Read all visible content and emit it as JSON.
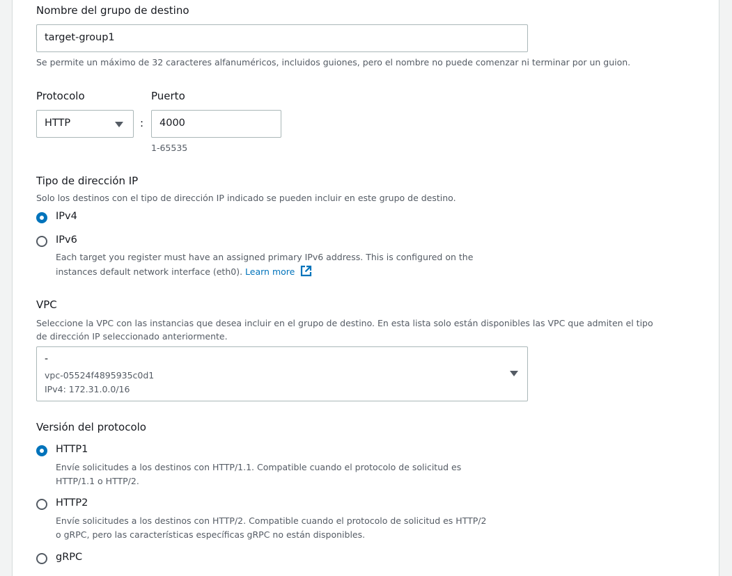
{
  "target_group_name": {
    "label": "Nombre del grupo de destino",
    "value": "target-group1",
    "hint": "Se permite un máximo de 32 caracteres alfanuméricos, incluidos guiones, pero el nombre no puede comenzar ni terminar por un guion."
  },
  "protocol": {
    "label": "Protocolo",
    "value": "HTTP",
    "separator": ":"
  },
  "port": {
    "label": "Puerto",
    "value": "4000",
    "hint": "1-65535"
  },
  "ip_address_type": {
    "label": "Tipo de dirección IP",
    "description": "Solo los destinos con el tipo de dirección IP indicado se pueden incluir en este grupo de destino.",
    "options": [
      {
        "label": "IPv4",
        "checked": true
      },
      {
        "label": "IPv6",
        "checked": false,
        "description_line1": "Each target you register must have an assigned primary IPv6 address. This is configured on the",
        "description_line2": "instances default network interface (eth0).",
        "learn_more": "Learn more"
      }
    ]
  },
  "vpc": {
    "label": "VPC",
    "description_line1": "Seleccione la VPC con las instancias que desea incluir en el grupo de destino. En esta lista solo están disponibles las VPC que admiten el tipo",
    "description_line2": "de dirección IP seleccionado anteriormente.",
    "selected_name": "-",
    "selected_id": "vpc-05524f4895935c0d1",
    "selected_cidr": "IPv4: 172.31.0.0/16"
  },
  "protocol_version": {
    "label": "Versión del protocolo",
    "options": [
      {
        "label": "HTTP1",
        "checked": true,
        "description_line1": "Envíe solicitudes a los destinos con HTTP/1.1. Compatible cuando el protocolo de solicitud es",
        "description_line2": "HTTP/1.1 o HTTP/2."
      },
      {
        "label": "HTTP2",
        "checked": false,
        "description_line1": "Envíe solicitudes a los destinos con HTTP/2. Compatible cuando el protocolo de solicitud es HTTP/2",
        "description_line2": "o gRPC, pero las características específicas gRPC no están disponibles."
      },
      {
        "label": "gRPC",
        "checked": false
      }
    ]
  },
  "colors": {
    "accent": "#0073bb",
    "border": "#aab7b8",
    "text": "#16191f",
    "muted": "#545b64"
  }
}
